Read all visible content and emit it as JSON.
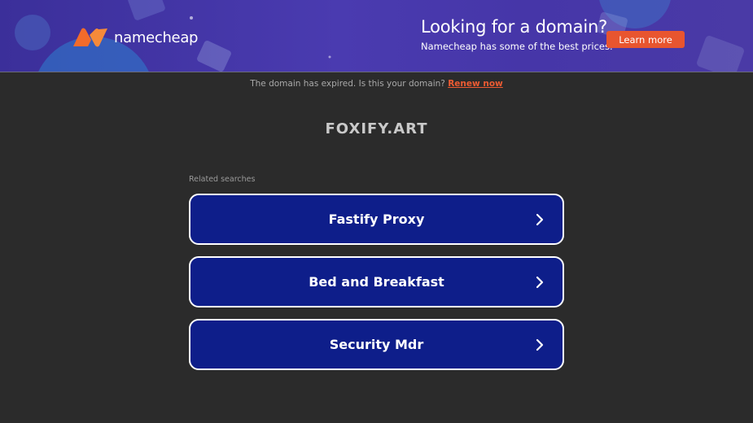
{
  "banner": {
    "logo_text": "namecheap",
    "promo_title": "Looking for a domain?",
    "promo_subtitle": "Namecheap has some of the best prices.",
    "cta_label": "Learn more",
    "colors": {
      "accent": "#e8552f",
      "background": "#4133a6"
    }
  },
  "notice": {
    "text": "The domain has expired. Is this your domain?",
    "link_text": "Renew now"
  },
  "domain_name": "FOXIFY.ART",
  "related": {
    "label": "Related searches",
    "items": [
      {
        "label": "Fastify Proxy",
        "icon": "chevron-right-icon"
      },
      {
        "label": "Bed and Breakfast",
        "icon": "chevron-right-icon"
      },
      {
        "label": "Security Mdr",
        "icon": "chevron-right-icon"
      }
    ]
  }
}
